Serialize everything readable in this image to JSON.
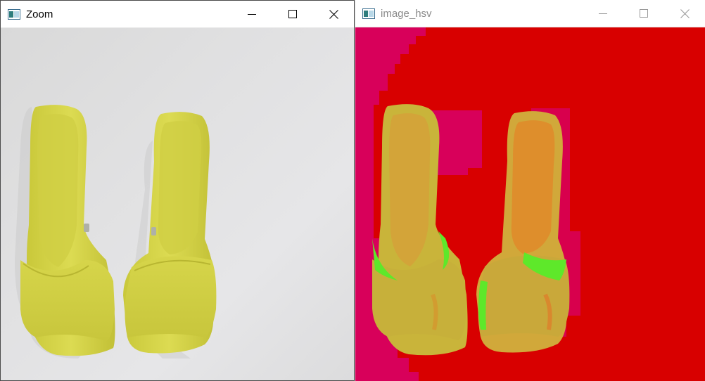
{
  "windows": [
    {
      "title": "Zoom",
      "controls": {
        "minimize": "minimize",
        "maximize": "maximize",
        "close": "close"
      }
    },
    {
      "title": "image_hsv",
      "controls": {
        "minimize": "minimize",
        "maximize": "maximize",
        "close": "close"
      }
    }
  ],
  "colors": {
    "title_active": "#000000",
    "title_inactive": "#8a8a8a",
    "sandal_yellow": "#d9d84a",
    "hsv_background": "#d80000",
    "hsv_magenta": "#d8005a",
    "hsv_green": "#5ee82a"
  },
  "icons": {
    "app": "opencv-window-icon",
    "minimize": "minimize-icon",
    "maximize": "maximize-icon",
    "close": "close-icon"
  }
}
